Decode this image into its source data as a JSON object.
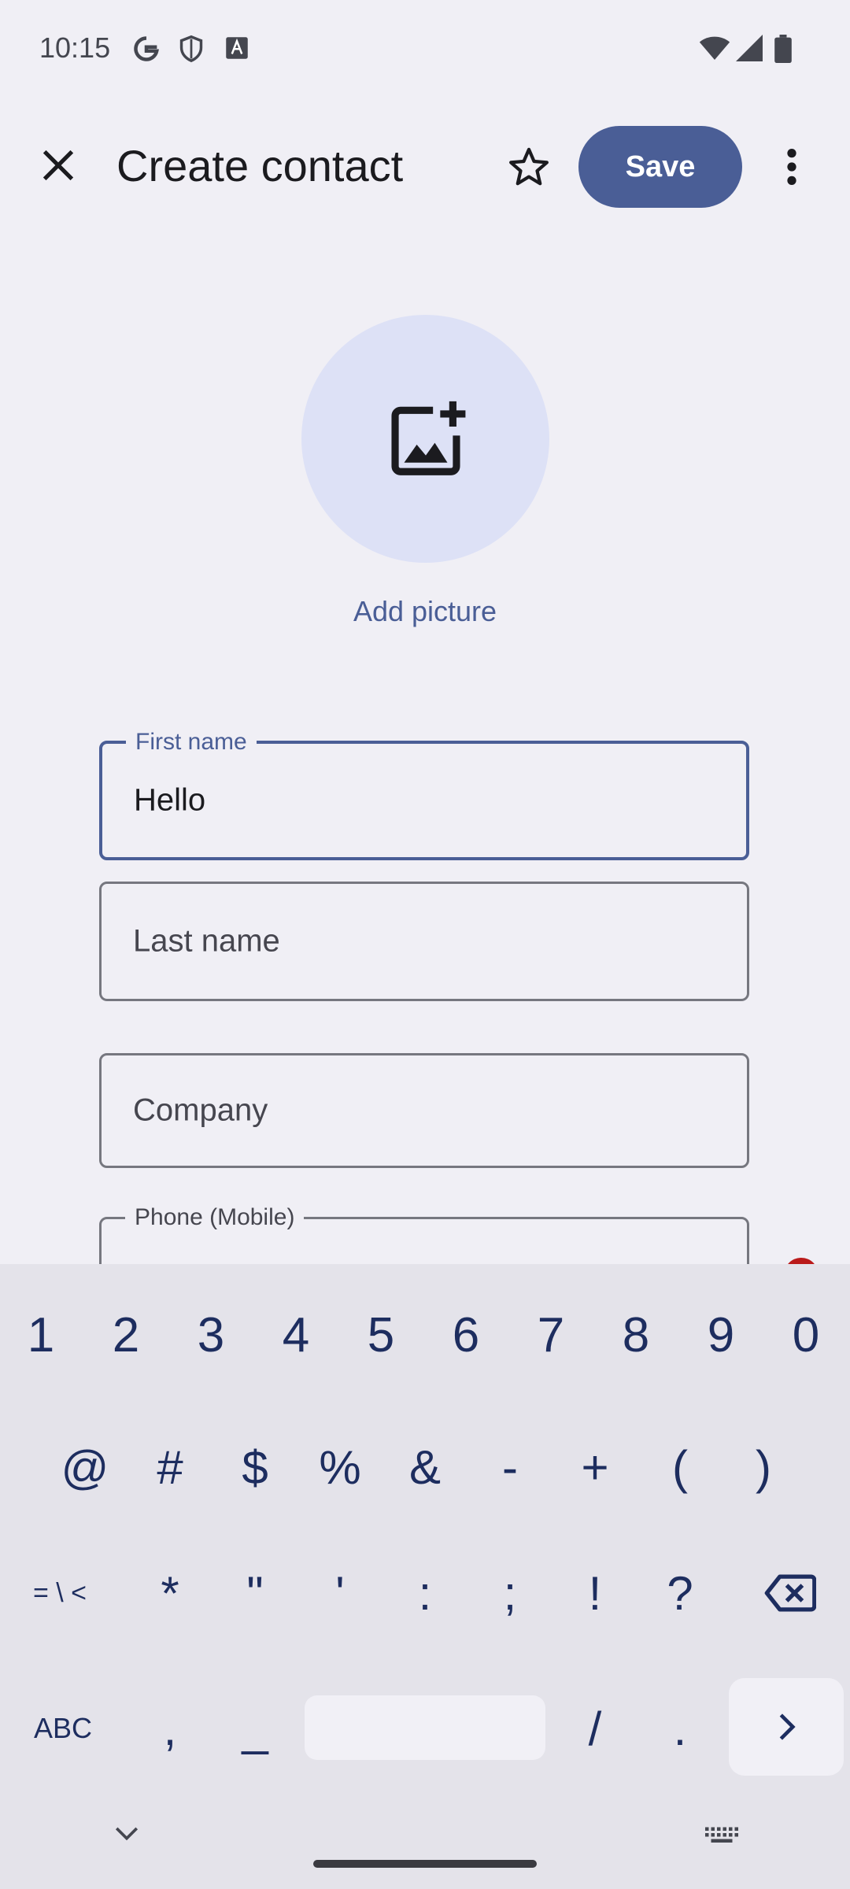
{
  "status_bar": {
    "time": "10:15"
  },
  "top_bar": {
    "title": "Create contact",
    "save_label": "Save"
  },
  "avatar": {
    "add_picture_label": "Add picture"
  },
  "fields": {
    "first_name": {
      "label": "First name",
      "value": "Hello"
    },
    "last_name": {
      "placeholder": "Last name"
    },
    "company": {
      "placeholder": "Company"
    },
    "phone": {
      "label": "Phone (Mobile)"
    }
  },
  "keyboard": {
    "row1": [
      "1",
      "2",
      "3",
      "4",
      "5",
      "6",
      "7",
      "8",
      "9",
      "0"
    ],
    "row2": [
      "@",
      "#",
      "$",
      "%",
      "&",
      "-",
      "+",
      "(",
      ")"
    ],
    "row3": [
      "= \\ <",
      "*",
      "\"",
      "'",
      ":",
      ";",
      "!",
      "?"
    ],
    "abc_label": "ABC",
    "row4": [
      ",",
      "_",
      "/",
      "."
    ]
  },
  "colors": {
    "accent": "#4a5e96",
    "background": "#f0eff5",
    "keyboard": "#e4e3ea"
  }
}
